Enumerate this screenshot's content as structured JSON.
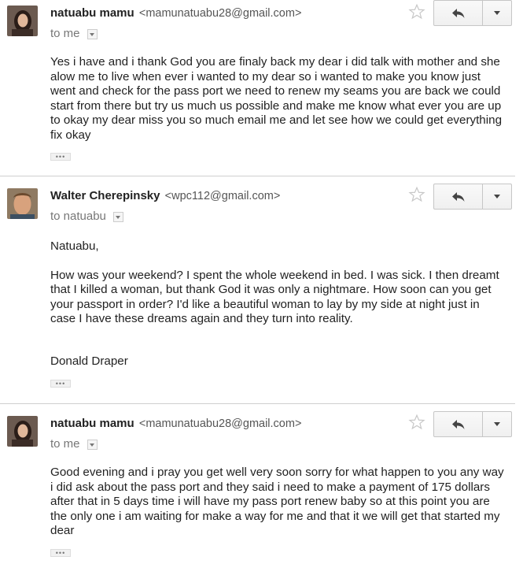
{
  "messages": [
    {
      "sender_name": "natuabu mamu",
      "sender_email": "<mamunatuabu28@gmail.com>",
      "recipient": "to me",
      "paragraphs": [
        "Yes i have and i thank God you are finaly back my dear i did talk with mother and she alow me to live when ever i wanted to my dear so i wanted to make you know just went and check for the pass port we need to renew my seams you are back we could start from there but try us much us possible and make me know what ever you are up to okay my dear miss you so much email me and let see how we could get everything fix okay"
      ],
      "ellipsis": "•••"
    },
    {
      "sender_name": "Walter Cherepinsky",
      "sender_email": "<wpc112@gmail.com>",
      "recipient": "to natuabu",
      "paragraphs": [
        "Natuabu,",
        "How was your weekend? I spent the whole weekend in bed. I was sick. I then dreamt that I killed a woman, but thank God it was only a nightmare. How soon can you get your passport in order? I'd like a beautiful woman to lay by my side at night just in case I have these dreams again and they turn into reality.",
        "Donald Draper"
      ],
      "ellipsis": "•••"
    },
    {
      "sender_name": "natuabu mamu",
      "sender_email": "<mamunatuabu28@gmail.com>",
      "recipient": "to me",
      "paragraphs": [
        "Good evening and i pray you get well very soon sorry for what happen to you any way i did ask about the pass port and they said i need to make a payment of 175 dollars after that in 5 days time i will have my pass port renew baby so at this point you are the only one i am waiting for make a way for me and that it we will get that started my dear"
      ],
      "ellipsis": "•••"
    }
  ],
  "colors": {
    "divider": "#cfcfcf",
    "button_border": "#c6c6c6",
    "text": "#222222",
    "muted": "#777777"
  },
  "icons": {
    "star": "star-icon",
    "reply": "reply-arrow-icon",
    "more": "chevron-down-icon"
  }
}
